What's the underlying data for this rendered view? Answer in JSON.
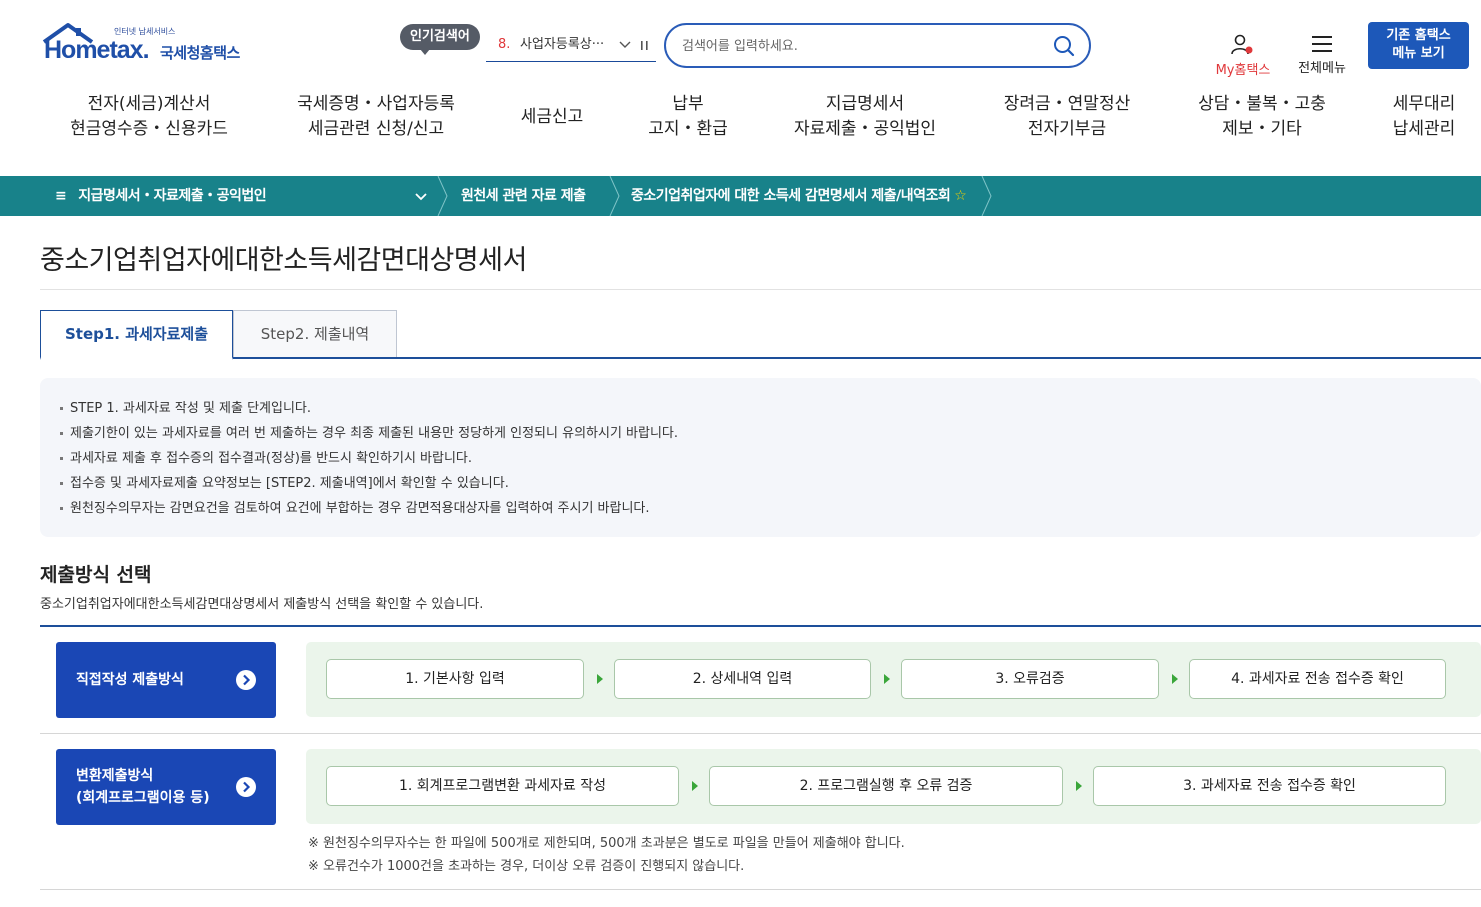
{
  "header": {
    "logo_tagline": "인터넷 납세서비스",
    "logo_word": "Hometax.",
    "logo_sub": "국세청홈택스",
    "popular_label": "인기검색어",
    "popular_rank": "8.",
    "popular_term": "사업자등록상···",
    "search_placeholder": "검색어를 입력하세요.",
    "my_hometax": "My홈택스",
    "all_menu": "전체메뉴",
    "old_menu_line1": "기존 홈택스",
    "old_menu_line2": "메뉴 보기",
    "colors": {
      "brand_blue": "#1d58b9",
      "accent_red": "#e0383b",
      "teal": "#18828a"
    }
  },
  "gnb": [
    {
      "line1": "전자(세금)계산서",
      "line2": "현금영수증・신용카드"
    },
    {
      "line1": "국세증명・사업자등록",
      "line2": "세금관련 신청/신고"
    },
    {
      "line1": "세금신고",
      "line2": ""
    },
    {
      "line1": "납부",
      "line2": "고지・환급"
    },
    {
      "line1": "지급명세서",
      "line2": "자료제출・공익법인"
    },
    {
      "line1": "장려금・연말정산",
      "line2": "전자기부금"
    },
    {
      "line1": "상담・불복・고충",
      "line2": "제보・기타"
    },
    {
      "line1": "세무대리",
      "line2": "납세관리"
    }
  ],
  "breadcrumb": {
    "menu_icon": "≡",
    "menu_label": "지급명세서・자료제출・공익법인",
    "items": [
      "원천세 관련 자료 제출",
      "중소기업취업자에 대한 소득세 감면명세서 제출/내역조회"
    ]
  },
  "page": {
    "title": "중소기업취업자에대한소득세감면대상명세서",
    "tabs": [
      {
        "label": "Step1. 과세자료제출",
        "active": true
      },
      {
        "label": "Step2. 제출내역",
        "active": false
      }
    ],
    "info": [
      "STEP 1. 과세자료 작성 및 제출 단계입니다.",
      "제출기한이 있는 과세자료를 여러 번 제출하는 경우 최종 제출된 내용만 정당하게 인정되니 유의하시기 바랍니다.",
      "과세자료 제출 후 접수증의 접수결과(정상)를 반드시 확인하기시 바랍니다.",
      "접수증 및 과세자료제출 요약정보는 [STEP2. 제출내역]에서 확인할 수 있습니다.",
      "원천징수의무자는 감면요건을 검토하여 요건에 부합하는 경우 감면적용대상자를 입력하여 주시기 바랍니다."
    ]
  },
  "section": {
    "title": "제출방식 선택",
    "desc": "중소기업취업자에대한소득세감면대상명세서 제출방식 선택을 확인할 수 있습니다.",
    "direct": {
      "label": "직접작성 제출방식",
      "steps": [
        "1. 기본사항 입력",
        "2. 상세내역 입력",
        "3. 오류검증",
        "4. 과세자료 전송 접수증 확인"
      ]
    },
    "convert": {
      "label_line1": "변환제출방식",
      "label_line2": "(회계프로그램이용 등)",
      "steps": [
        "1. 회계프로그램변환 과세자료 작성",
        "2. 프로그램실행 후 오류 검증",
        "3. 과세자료 전송 접수증 확인"
      ]
    },
    "notes": [
      "※ 원천징수의무자수는 한 파일에 500개로 제한되며, 500개 초과분은 별도로 파일을 만들어 제출해야 합니다.",
      "※ 오류건수가 1000건을 초과하는 경우, 더이상 오류 검증이 진행되지 않습니다."
    ]
  }
}
